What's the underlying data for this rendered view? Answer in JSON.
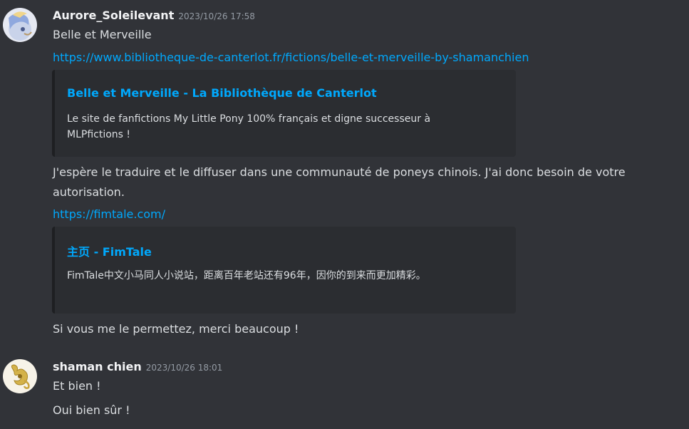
{
  "messages": [
    {
      "username": "Aurore_Soleilevant",
      "timestamp": "2023/10/26 17:58",
      "avatar_icon": "pony-avatar-icon",
      "lines": {
        "text1": "Belle et Merveille",
        "link1": "https://www.bibliotheque-de-canterlot.fr/fictions/belle-et-merveille-by-shamanchien",
        "text2": "J'espère le traduire et le diffuser dans une communauté de poneys chinois. J'ai donc besoin de votre autorisation.",
        "link2": "https://fimtale.com/",
        "text3": "Si vous me le permettez, merci beaucoup !"
      },
      "embeds": [
        {
          "title": "Belle et Merveille - La Bibliothèque de Canterlot",
          "description": "Le site de fanfictions My Little Pony 100% français et digne successeur à MLPfictions !"
        },
        {
          "title": "主页 - FimTale",
          "description": "FimTale中文小马同人小说站，距离百年老站还有96年，因你的到来而更加精彩。"
        }
      ]
    },
    {
      "username": "shaman chien",
      "timestamp": "2023/10/26 18:01",
      "avatar_icon": "capricorn-emblem-icon",
      "lines": {
        "text1": "Et bien !",
        "text2": "Oui bien sûr !"
      }
    }
  ],
  "colors": {
    "background": "#313338",
    "embed_background": "#2b2d31",
    "link": "#00a8fc",
    "username": "#f2f3f5",
    "timestamp": "#949ba4",
    "text": "#dbdee1"
  }
}
